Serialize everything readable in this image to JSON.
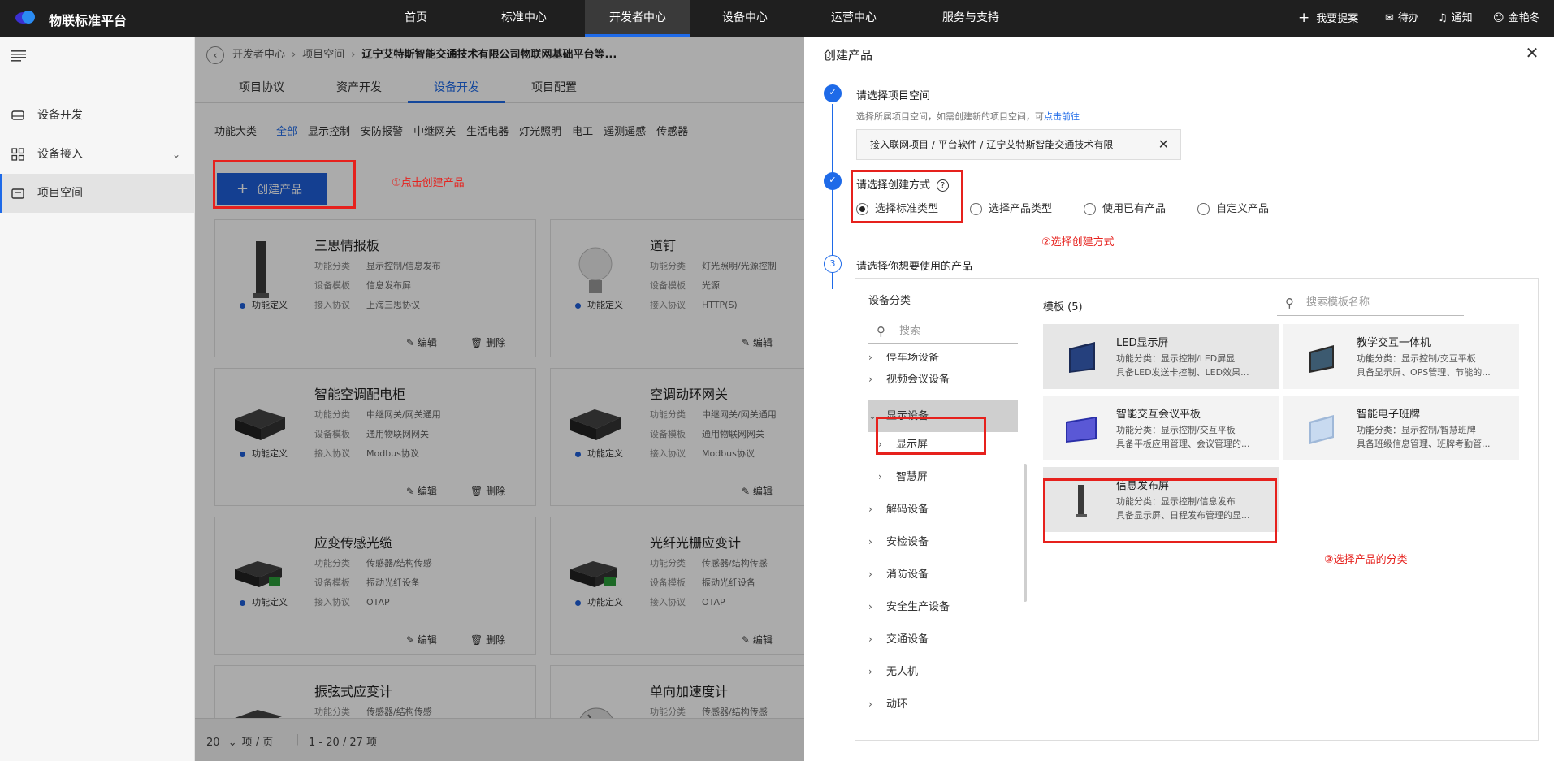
{
  "topnav": {
    "brand": "物联标准平台",
    "items": [
      "首页",
      "标准中心",
      "开发者中心",
      "设备中心",
      "运营中心",
      "服务与支持"
    ],
    "right": [
      "我要提案",
      "待办",
      "通知",
      "金艳冬"
    ]
  },
  "sidebar": {
    "items": [
      "设备开发",
      "设备接入",
      "项目空间"
    ]
  },
  "breadcrumb": {
    "items": [
      "开发者中心",
      "项目空间",
      "辽宁艾特斯智能交通技术有限公司物联网基础平台等..."
    ]
  },
  "tabs": [
    "项目协议",
    "资产开发",
    "设备开发",
    "项目配置"
  ],
  "categories": {
    "label": "功能大类",
    "items": [
      "全部",
      "显示控制",
      "安防报警",
      "中继网关",
      "生活电器",
      "灯光照明",
      "电工",
      "遥测遥感",
      "传感器"
    ]
  },
  "create_button": "创建产品",
  "annotations": {
    "a1": "①点击创建产品",
    "a2": "②选择创建方式",
    "a3": "③选择产品的分类"
  },
  "cards": [
    {
      "title": "三思情报板",
      "cls": "显示控制/信息发布",
      "tpl": "信息发布屏",
      "proto": "上海三思协议",
      "status": "功能定义",
      "edit": "编辑",
      "del": "删除"
    },
    {
      "title": "道钉",
      "cls": "灯光照明/光源控制",
      "tpl": "光源",
      "proto": "HTTP(S)",
      "status": "功能定义",
      "edit": "编辑",
      "del": ""
    },
    {
      "title": "智能空调配电柜",
      "cls": "中继网关/网关通用",
      "tpl": "通用物联网网关",
      "proto": "Modbus协议",
      "status": "功能定义",
      "edit": "编辑",
      "del": "删除"
    },
    {
      "title": "空调动环网关",
      "cls": "中继网关/网关通用",
      "tpl": "通用物联网网关",
      "proto": "Modbus协议",
      "status": "功能定义",
      "edit": "编辑",
      "del": ""
    },
    {
      "title": "应变传感光缆",
      "cls": "传感器/结构传感",
      "tpl": "振动光纤设备",
      "proto": "OTAP",
      "status": "功能定义",
      "edit": "编辑",
      "del": "删除"
    },
    {
      "title": "光纤光栅应变计",
      "cls": "传感器/结构传感",
      "tpl": "振动光纤设备",
      "proto": "OTAP",
      "status": "功能定义",
      "edit": "编辑",
      "del": ""
    },
    {
      "title": "振弦式应变计",
      "cls": "传感器/结构传感",
      "tpl": "",
      "proto": "",
      "status": "",
      "edit": "",
      "del": ""
    },
    {
      "title": "单向加速度计",
      "cls": "传感器/结构传感",
      "tpl": "",
      "proto": "",
      "status": "",
      "edit": "",
      "del": ""
    }
  ],
  "card_keys": {
    "cls": "功能分类",
    "tpl": "设备模板",
    "proto": "接入协议"
  },
  "pager": {
    "size": "20",
    "unit": "项 / 页",
    "range": "1 - 20 / 27 项"
  },
  "drawer": {
    "title": "创建产品",
    "step1": {
      "title": "请选择项目空间",
      "desc": "选择所属项目空间，如需创建新的项目空间，可",
      "link": "点击前往",
      "chip": "接入联网项目 / 平台软件 / 辽宁艾特斯智能交通技术有限"
    },
    "step2": {
      "title": "请选择创建方式",
      "help": "?",
      "options": [
        "选择标准类型",
        "选择产品类型",
        "使用已有产品",
        "自定义产品"
      ]
    },
    "step3": {
      "num": "3",
      "title": "请选择你想要使用的产品"
    },
    "left": {
      "head": "设备分类",
      "search_placeholder": "搜索",
      "tree": [
        "停车场设备",
        "视频会议设备",
        "显示设备",
        "显示屏",
        "智慧屏",
        "解码设备",
        "安检设备",
        "消防设备",
        "安全生产设备",
        "交通设备",
        "无人机",
        "动环"
      ]
    },
    "right": {
      "head": "模板 (5)",
      "search_placeholder": "搜索模板名称",
      "templates": [
        {
          "name": "LED显示屏",
          "l1": "功能分类：显示控制/LED屏显",
          "l2": "具备LED发送卡控制、LED效果..."
        },
        {
          "name": "教学交互一体机",
          "l1": "功能分类：显示控制/交互平板",
          "l2": "具备显示屏、OPS管理、节能的..."
        },
        {
          "name": "智能交互会议平板",
          "l1": "功能分类：显示控制/交互平板",
          "l2": "具备平板应用管理、会议管理的..."
        },
        {
          "name": "智能电子班牌",
          "l1": "功能分类：显示控制/智慧班牌",
          "l2": "具备班级信息管理、班牌考勤管..."
        },
        {
          "name": "信息发布屏",
          "l1": "功能分类：显示控制/信息发布",
          "l2": "具备显示屏、日程发布管理的显..."
        }
      ]
    }
  },
  "colors": {
    "accent": "#1e6ae8",
    "annotation": "#e6211d",
    "topbar": "#1f1f1f"
  }
}
